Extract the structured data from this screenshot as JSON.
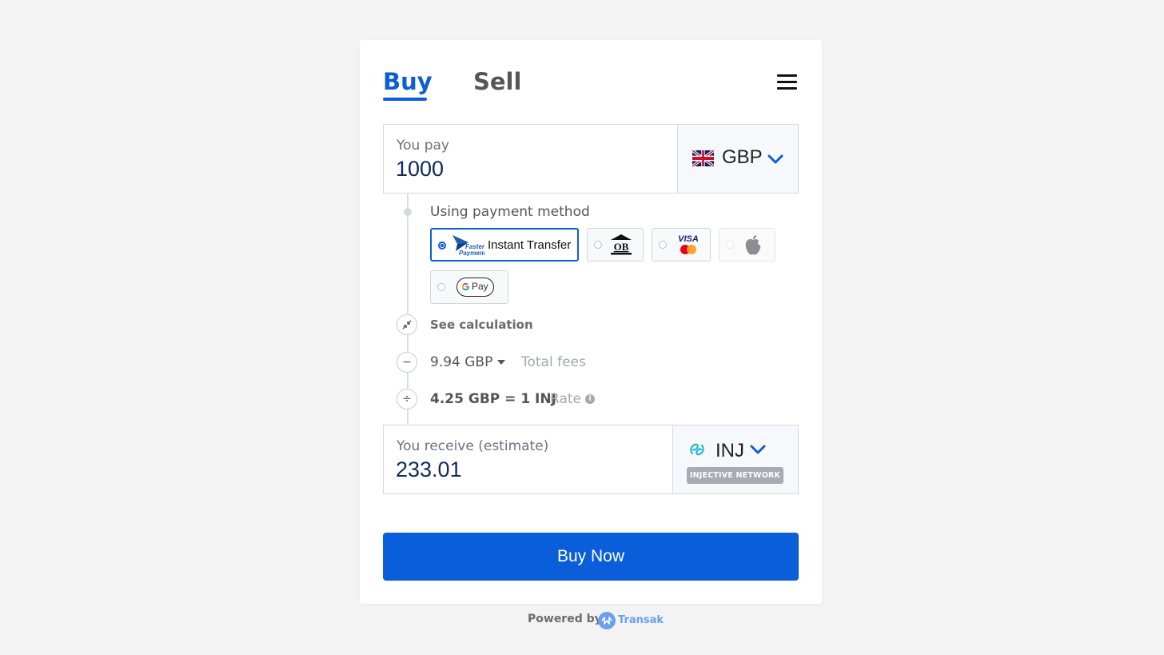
{
  "tabs": {
    "buy": "Buy",
    "sell": "Sell"
  },
  "pay": {
    "label": "You pay",
    "value": "1000",
    "currency": "GBP"
  },
  "payment_method": {
    "label": "Using payment method",
    "options": [
      {
        "name": "faster-payments",
        "brand_line1": "Faster",
        "brand_line2": "Payments",
        "text": "Instant Transfer",
        "selected": true
      },
      {
        "name": "open-banking",
        "text": "OB",
        "selected": false
      },
      {
        "name": "card",
        "brand": "VISA",
        "selected": false
      },
      {
        "name": "apple-pay",
        "selected": false,
        "disabled": true
      },
      {
        "name": "google-pay",
        "text": "Pay",
        "selected": false
      }
    ]
  },
  "calculation": {
    "see_calculation": "See calculation",
    "fees_value": "9.94 GBP",
    "fees_label": "Total fees",
    "rate_value": "4.25 GBP = 1 INJ",
    "rate_label": "Rate"
  },
  "receive": {
    "label": "You receive (estimate)",
    "value": "233.01",
    "currency": "INJ",
    "network": "INJECTIVE NETWORK"
  },
  "buy_button": "Buy Now",
  "footer": {
    "powered_by": "Powered by",
    "brand": "Transak"
  },
  "colors": {
    "accent": "#0b5ed7",
    "background": "#f3f3f3",
    "card": "#ffffff"
  }
}
